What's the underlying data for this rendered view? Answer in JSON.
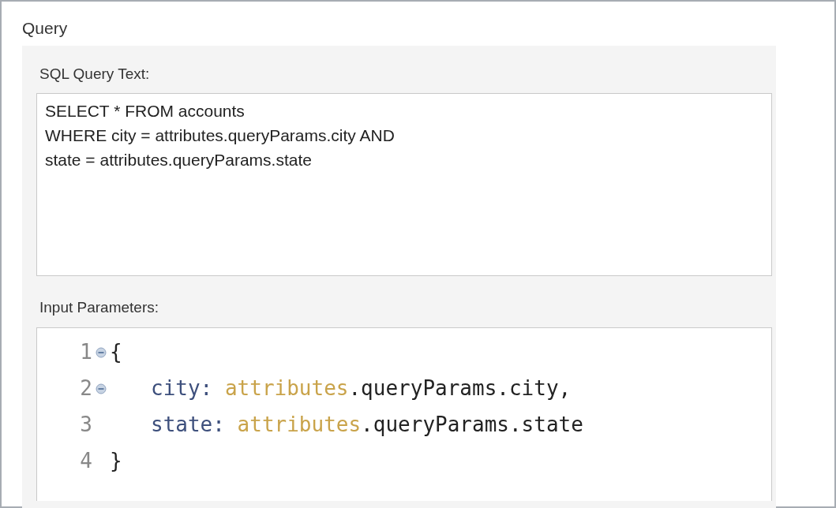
{
  "section": {
    "title": "Query"
  },
  "sql": {
    "label": "SQL Query Text:",
    "lines": [
      "SELECT * FROM accounts",
      "WHERE city = attributes.queryParams.city AND",
      "state = attributes.queryParams.state"
    ]
  },
  "params": {
    "label": "Input Parameters:",
    "lines": [
      {
        "number": "1",
        "foldable": true,
        "indent": false,
        "tokens": [
          {
            "kind": "plain",
            "text": "{"
          }
        ]
      },
      {
        "number": "2",
        "foldable": true,
        "indent": true,
        "tokens": [
          {
            "kind": "key",
            "text": "city:"
          },
          {
            "kind": "object",
            "text": "attributes"
          },
          {
            "kind": "plain",
            "text": ".queryParams.city,"
          }
        ]
      },
      {
        "number": "3",
        "foldable": false,
        "indent": true,
        "tokens": [
          {
            "kind": "key",
            "text": "state:"
          },
          {
            "kind": "object",
            "text": "attributes"
          },
          {
            "kind": "plain",
            "text": ".queryParams.state"
          }
        ]
      },
      {
        "number": "4",
        "foldable": false,
        "indent": false,
        "tokens": [
          {
            "kind": "plain",
            "text": "}"
          }
        ]
      }
    ]
  }
}
